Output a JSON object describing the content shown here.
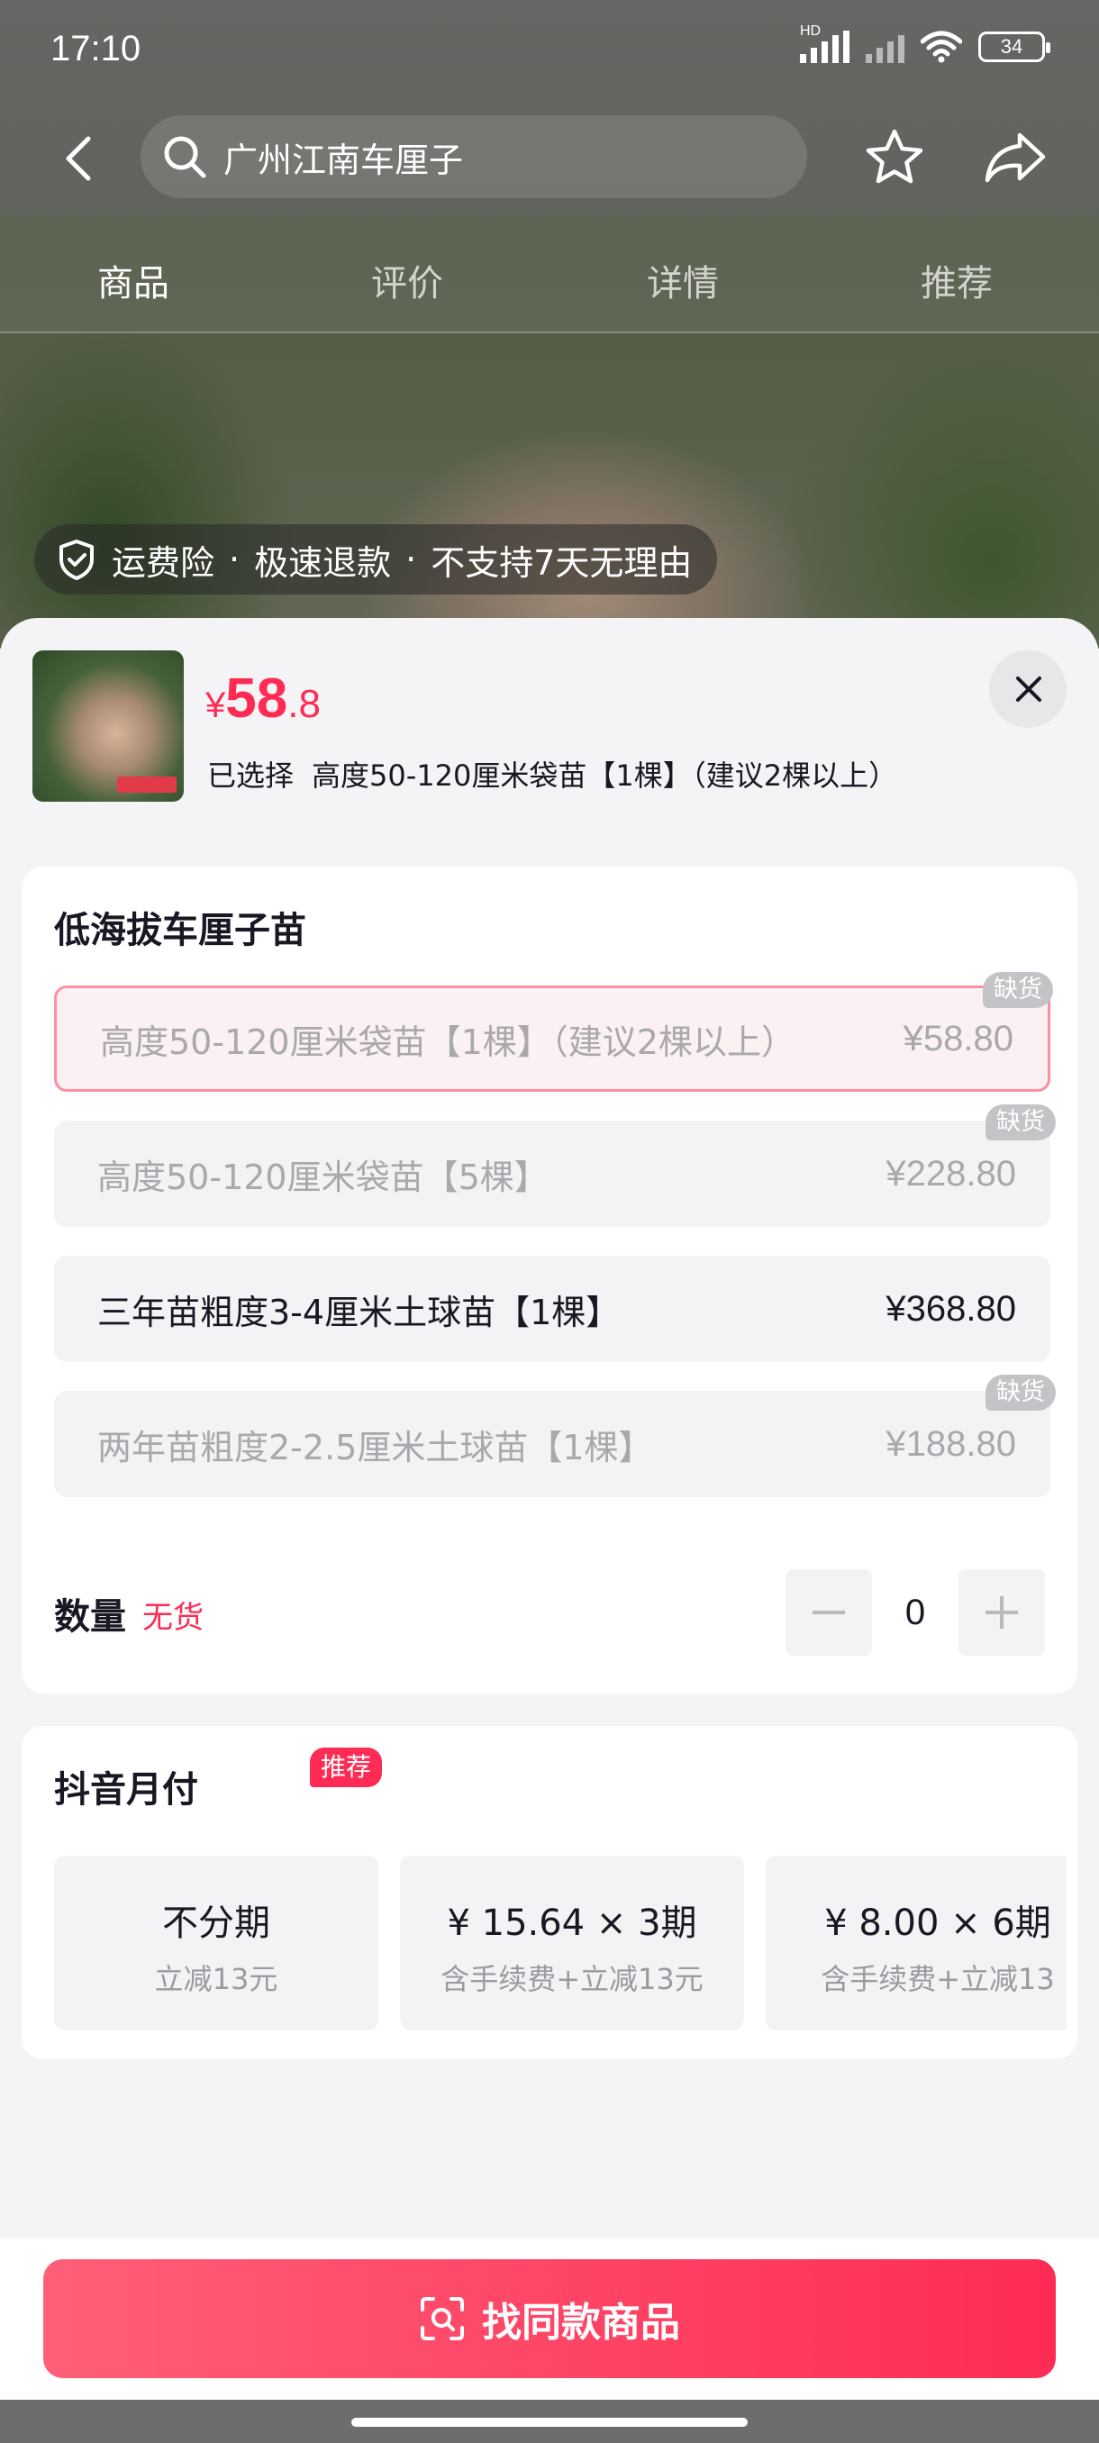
{
  "status_bar": {
    "time": "17:10",
    "hd_label": "HD",
    "battery": "34"
  },
  "nav": {
    "search_text": "广州江南车厘子",
    "icons": {
      "back": "back-arrow-icon",
      "search": "search-icon",
      "favorite": "star-icon",
      "share": "share-icon"
    }
  },
  "tabs": [
    {
      "label": "商品"
    },
    {
      "label": "评价"
    },
    {
      "label": "详情"
    },
    {
      "label": "推荐"
    }
  ],
  "guarantee": {
    "items": [
      "运费险",
      "·",
      "极速退款",
      "·",
      "不支持7天无理由"
    ]
  },
  "product": {
    "currency": "¥",
    "price_int": "58",
    "price_dec": ".8",
    "selected_label": "已选择",
    "selected_value": "高度50-120厘米袋苗【1棵】（建议2棵以上）"
  },
  "spec": {
    "title": "低海拔车厘子苗",
    "options": [
      {
        "label": "高度50-120厘米袋苗【1棵】（建议2棵以上）",
        "price": "¥58.80",
        "badge": "缺货"
      },
      {
        "label": "高度50-120厘米袋苗【5棵】",
        "price": "¥228.80",
        "badge": "缺货"
      },
      {
        "label": "三年苗粗度3-4厘米土球苗【1棵】",
        "price": "¥368.80",
        "badge": ""
      },
      {
        "label": "两年苗粗度2-2.5厘米土球苗【1棵】",
        "price": "¥188.80",
        "badge": "缺货"
      }
    ],
    "quantity_label": "数量",
    "quantity_status": "无货",
    "quantity_value": "0"
  },
  "payment": {
    "title": "抖音月付",
    "recommend_badge": "推荐",
    "plans": [
      {
        "main": "不分期",
        "sub": "立减13元"
      },
      {
        "main": "¥ 15.64 × 3期",
        "sub": "含手续费+立减13元"
      },
      {
        "main": "¥ 8.00 × 6期",
        "sub": "含手续费+立减13"
      }
    ]
  },
  "cta": {
    "label": "找同款商品",
    "icon": "scan-icon"
  },
  "colors": {
    "accent": "#fe2c55",
    "sheet_bg": "#f4f4f6",
    "disabled_text": "#a8a8ad"
  }
}
